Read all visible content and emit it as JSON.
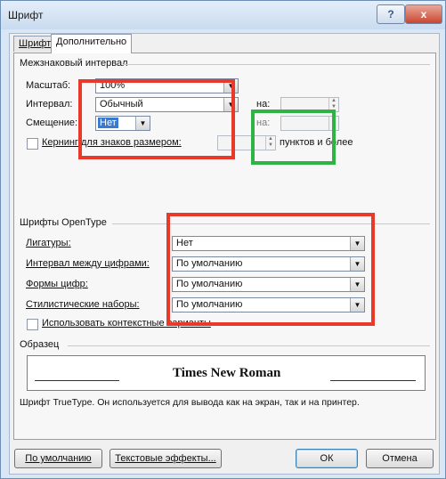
{
  "window": {
    "title": "Шрифт",
    "help_glyph": "?",
    "close_glyph": "x"
  },
  "tabs": [
    {
      "label": "Шрифт",
      "active": false
    },
    {
      "label": "Дополнительно",
      "active": true
    }
  ],
  "spacing": {
    "section_title": "Межзнаковый интервал",
    "scale": {
      "label": "Масштаб:",
      "value": "100%"
    },
    "interval": {
      "label": "Интервал:",
      "value": "Обычный",
      "by_label": "на:",
      "by_value": ""
    },
    "offset": {
      "label": "Смещение:",
      "value": "Нет",
      "by_label": "на:",
      "by_value": ""
    },
    "kerning": {
      "label": "Кернинг для знаков размером:",
      "value": "",
      "suffix": "пунктов и более",
      "checked": false
    }
  },
  "opentype": {
    "section_title": "Шрифты OpenType",
    "ligatures": {
      "label": "Лигатуры:",
      "value": "Нет"
    },
    "number_spacing": {
      "label": "Интервал между цифрами:",
      "value": "По умолчанию"
    },
    "number_forms": {
      "label": "Формы цифр:",
      "value": "По умолчанию"
    },
    "stylistic_sets": {
      "label": "Стилистические наборы:",
      "value": "По умолчанию"
    },
    "contextual": {
      "label": "Использовать контекстные варианты",
      "checked": false
    }
  },
  "preview": {
    "section_title": "Образец",
    "sample_text": "Times New Roman",
    "description": "Шрифт TrueType. Он используется для вывода как на экран, так и на принтер."
  },
  "buttons": {
    "default": "По умолчанию",
    "text_effects": "Текстовые эффекты...",
    "ok": "ОК",
    "cancel": "Отмена"
  },
  "highlights": {
    "red": "#e8392a",
    "green": "#2fb344"
  }
}
